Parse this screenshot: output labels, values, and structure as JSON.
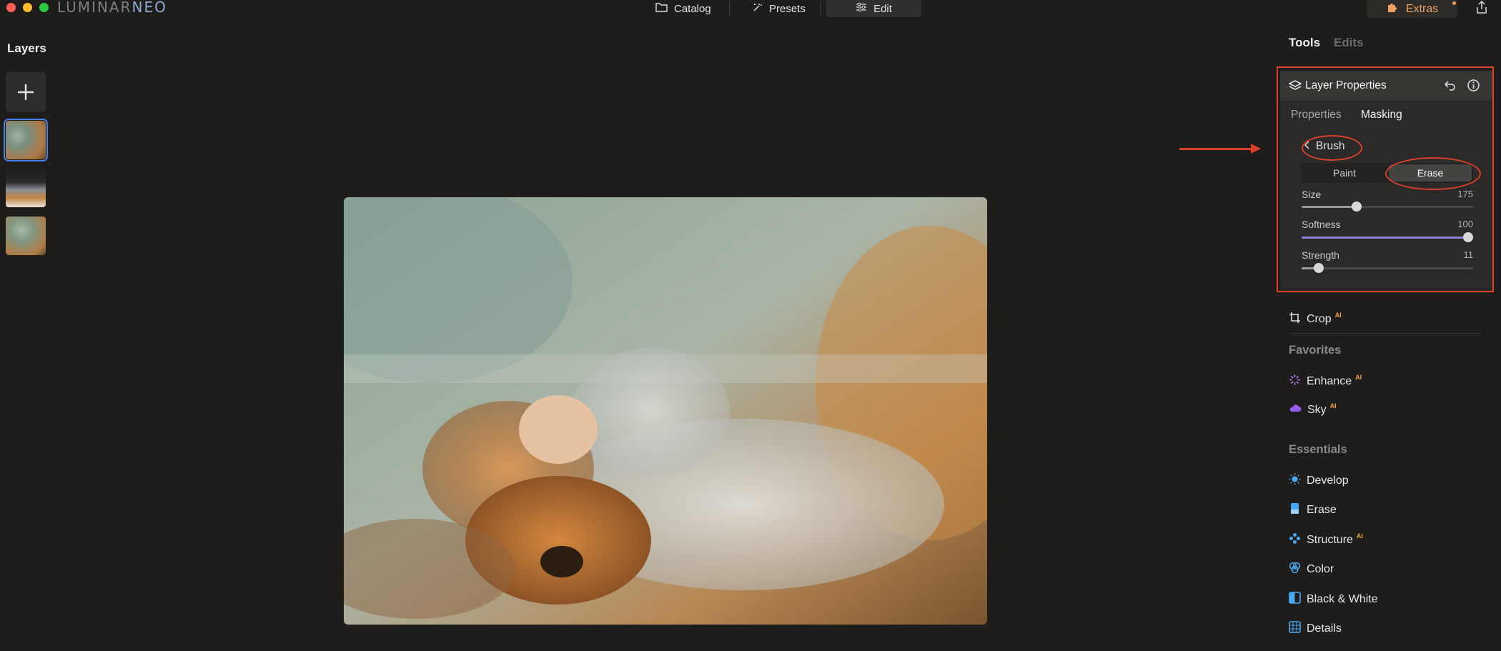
{
  "app": {
    "logo_main": "LUMINAR",
    "logo_accent": "NEO"
  },
  "topnav": {
    "catalog": "Catalog",
    "presets": "Presets",
    "edit": "Edit",
    "extras": "Extras"
  },
  "layers": {
    "title": "Layers"
  },
  "panel": {
    "tabs": {
      "tools": "Tools",
      "edits": "Edits"
    },
    "layer_properties": {
      "title": "Layer Properties",
      "subtabs": {
        "properties": "Properties",
        "masking": "Masking"
      },
      "brush_label": "Brush",
      "modes": {
        "paint": "Paint",
        "erase": "Erase",
        "selected": "Erase"
      },
      "sliders": {
        "size": {
          "label": "Size",
          "value": "175",
          "fraction": 0.35
        },
        "softness": {
          "label": "Softness",
          "value": "100",
          "fraction": 1.0
        },
        "strength": {
          "label": "Strength",
          "value": "11",
          "fraction": 0.11
        }
      }
    },
    "crop": {
      "label": "Crop",
      "ai": "AI"
    },
    "favorites": {
      "heading": "Favorites",
      "items": [
        {
          "label": "Enhance",
          "ai": "AI"
        },
        {
          "label": "Sky",
          "ai": "AI"
        }
      ]
    },
    "essentials": {
      "heading": "Essentials",
      "items": [
        {
          "label": "Develop"
        },
        {
          "label": "Erase"
        },
        {
          "label": "Structure",
          "ai": "AI"
        },
        {
          "label": "Color"
        },
        {
          "label": "Black & White"
        },
        {
          "label": "Details"
        }
      ]
    }
  },
  "colors": {
    "annotation": "#d8402a",
    "accent_blue": "#4a7fe8",
    "extras_orange": "#f0a060",
    "softness_track": "#8b7fd8"
  }
}
